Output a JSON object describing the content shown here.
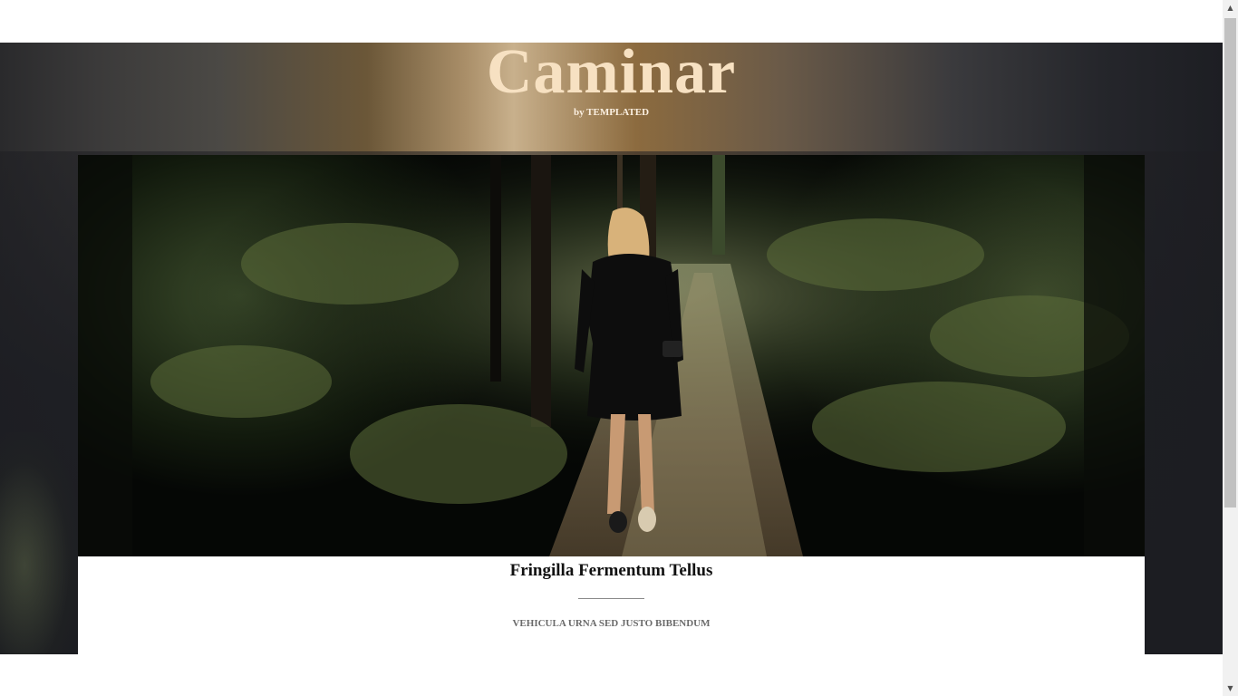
{
  "header": {
    "title": "Caminar",
    "subtitle": "by TEMPLATED"
  },
  "banner": {
    "image_subject": "woman-walking-forest-path-photo"
  },
  "caption": {
    "title": "Fringilla Fermentum Tellus",
    "subtitle": "VEHICULA URNA SED JUSTO BIBENDUM"
  },
  "scrollbar": {
    "up_icon": "triangle-up-icon",
    "down_icon": "triangle-down-icon"
  },
  "colors": {
    "title": "#f7e1c2",
    "hero_dark": "#1c1d22",
    "hero_warm": "#c8b08c"
  }
}
